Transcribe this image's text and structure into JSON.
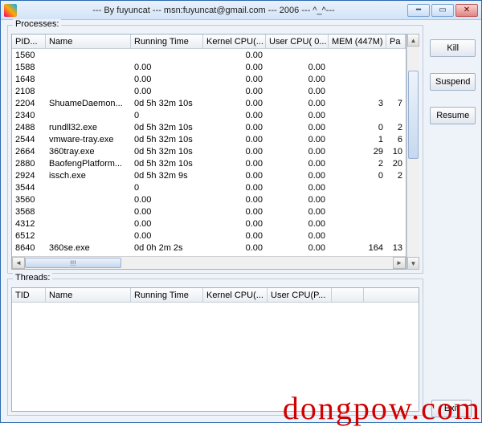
{
  "window": {
    "title": "--- By fuyuncat --- msn:fuyuncat@gmail.com --- 2006 --- ^_^---"
  },
  "buttons": {
    "kill": "Kill",
    "suspend": "Suspend",
    "resume": "Resume",
    "exit": "Exit"
  },
  "processes": {
    "label": "Processes:",
    "columns": [
      "PID...",
      "Name",
      "Running Time",
      "Kernel CPU(...",
      "User CPU( 0...",
      "MEM (447M)",
      "Pa"
    ],
    "rows": [
      {
        "pid": "1560",
        "name": "",
        "run": "",
        "kcpu": "0.00",
        "ucpu": "",
        "mem": "",
        "pa": ""
      },
      {
        "pid": "1588",
        "name": "",
        "run": "0.00",
        "kcpu": "0.00",
        "ucpu": "0.00",
        "mem": "",
        "pa": ""
      },
      {
        "pid": "1648",
        "name": "",
        "run": "0.00",
        "kcpu": "0.00",
        "ucpu": "0.00",
        "mem": "",
        "pa": ""
      },
      {
        "pid": "2108",
        "name": "",
        "run": "0.00",
        "kcpu": "0.00",
        "ucpu": "0.00",
        "mem": "",
        "pa": ""
      },
      {
        "pid": "2204",
        "name": "ShuameDaemon...",
        "run": "0d 5h 32m 10s",
        "kcpu": "0.00",
        "ucpu": "0.00",
        "mem": "3",
        "pa": "7"
      },
      {
        "pid": "2340",
        "name": "",
        "run": "0",
        "kcpu": "0.00",
        "ucpu": "0.00",
        "mem": "",
        "pa": ""
      },
      {
        "pid": "2488",
        "name": "rundll32.exe",
        "run": "0d 5h 32m 10s",
        "kcpu": "0.00",
        "ucpu": "0.00",
        "mem": "0",
        "pa": "2"
      },
      {
        "pid": "2544",
        "name": "vmware-tray.exe",
        "run": "0d 5h 32m 10s",
        "kcpu": "0.00",
        "ucpu": "0.00",
        "mem": "1",
        "pa": "6"
      },
      {
        "pid": "2664",
        "name": "360tray.exe",
        "run": "0d 5h 32m 10s",
        "kcpu": "0.00",
        "ucpu": "0.00",
        "mem": "29",
        "pa": "10"
      },
      {
        "pid": "2880",
        "name": "BaofengPlatform...",
        "run": "0d 5h 32m 10s",
        "kcpu": "0.00",
        "ucpu": "0.00",
        "mem": "2",
        "pa": "20"
      },
      {
        "pid": "2924",
        "name": "issch.exe",
        "run": "0d 5h 32m 9s",
        "kcpu": "0.00",
        "ucpu": "0.00",
        "mem": "0",
        "pa": "2"
      },
      {
        "pid": "3544",
        "name": "",
        "run": "0",
        "kcpu": "0.00",
        "ucpu": "0.00",
        "mem": "",
        "pa": ""
      },
      {
        "pid": "3560",
        "name": "",
        "run": "0.00",
        "kcpu": "0.00",
        "ucpu": "0.00",
        "mem": "",
        "pa": ""
      },
      {
        "pid": "3568",
        "name": "",
        "run": "0.00",
        "kcpu": "0.00",
        "ucpu": "0.00",
        "mem": "",
        "pa": ""
      },
      {
        "pid": "4312",
        "name": "",
        "run": "0.00",
        "kcpu": "0.00",
        "ucpu": "0.00",
        "mem": "",
        "pa": ""
      },
      {
        "pid": "6512",
        "name": "",
        "run": "0.00",
        "kcpu": "0.00",
        "ucpu": "0.00",
        "mem": "",
        "pa": ""
      },
      {
        "pid": "8640",
        "name": "360se.exe",
        "run": "0d 0h 2m 2s",
        "kcpu": "0.00",
        "ucpu": "0.00",
        "mem": "164",
        "pa": "13"
      }
    ],
    "hscroll_label": "!!!"
  },
  "threads": {
    "label": "Threads:",
    "columns": [
      "TID",
      "Name",
      "Running Time",
      "Kernel CPU(...",
      "User CPU(P...",
      ""
    ]
  },
  "watermark": "dongpow.com"
}
